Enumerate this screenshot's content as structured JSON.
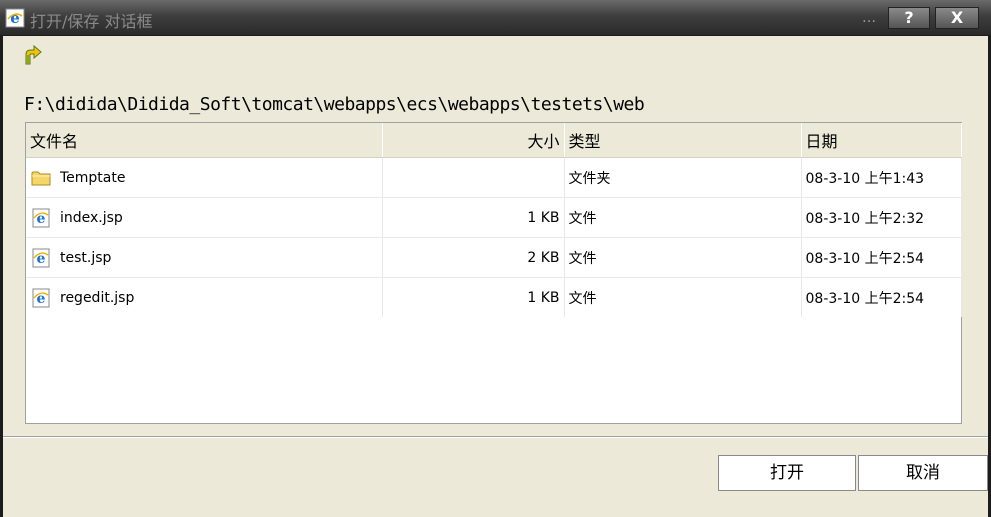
{
  "window": {
    "title": "打开/保存 对话框",
    "dots": "…",
    "help_label": "?",
    "close_label": "X"
  },
  "toolbar": {
    "up_icon": "up-folder-icon"
  },
  "path": "F:\\didida\\Didida_Soft\\tomcat\\webapps\\ecs\\webapps\\testets\\web",
  "table": {
    "columns": [
      "文件名",
      "大小",
      "类型",
      "日期"
    ],
    "rows": [
      {
        "icon": "folder-icon",
        "name": "Temptate",
        "size": "",
        "type": "文件夹",
        "date": "08-3-10 上午1:43"
      },
      {
        "icon": "ie-file-icon",
        "name": "index.jsp",
        "size": "1 KB",
        "type": "文件",
        "date": "08-3-10 上午2:32"
      },
      {
        "icon": "ie-file-icon",
        "name": "test.jsp",
        "size": "2 KB",
        "type": "文件",
        "date": "08-3-10 上午2:54"
      },
      {
        "icon": "ie-file-icon",
        "name": "regedit.jsp",
        "size": "1 KB",
        "type": "文件",
        "date": "08-3-10 上午2:54"
      }
    ]
  },
  "buttons": {
    "open": "打开",
    "cancel": "取消"
  },
  "colors": {
    "titlebar": "#3e3e3e",
    "dialog_bg": "#ece9d8",
    "folder": "#f5d66a"
  }
}
